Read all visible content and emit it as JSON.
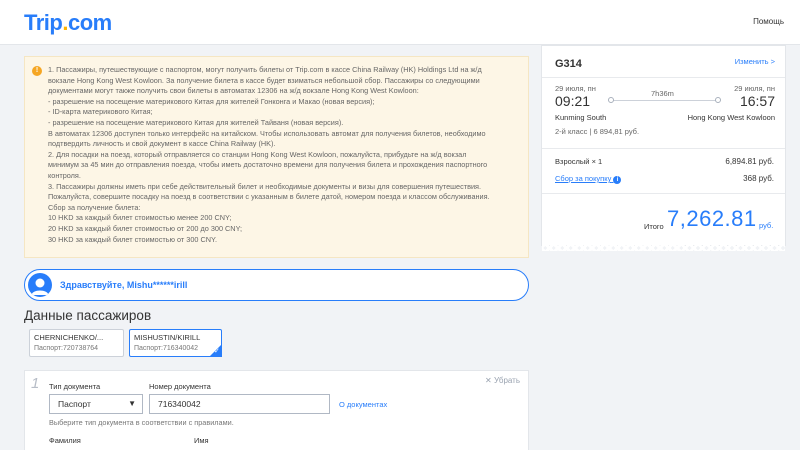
{
  "header": {
    "logo_main": "Trip",
    "logo_dot": ".",
    "logo_suffix": "com",
    "help": "Помощь"
  },
  "notice": {
    "icon": "!",
    "lines": [
      "1. Пассажиры, путешествующие с паспортом, могут получить билеты от Trip.com в кассе China Railway (HK) Holdings Ltd на ж/д",
      "вокзале Hong Kong West Kowloon. За получение билета в кассе будет взиматься небольшой сбор. Пассажиры со следующими",
      "документами могут также получить свои билеты в автоматах 12306 на ж/д вокзале Hong Kong West Kowloon:",
      "- разрешение на посещение материкового Китая для жителей Гонконга и Макао (новая версия);",
      "- ID-карта материкового Китая;",
      "- разрешение на посещение материкового Китая для жителей Тайваня (новая версия).",
      "В автоматах 12306 доступен только интерфейс на китайском. Чтобы использовать автомат для получения билетов, необходимо",
      "подтвердить личность и свой документ в кассе China Railway (HK).",
      "2. Для посадки на поезд, который отправляется со станции Hong Kong West Kowloon, пожалуйста, прибудьте на ж/д вокзал",
      "минимум за 45 мин до отправления поезда, чтобы иметь достаточно времени для получения билета и прохождения паспортного",
      "контроля.",
      "3. Пассажиры должны иметь при себе действительный билет и необходимые документы и визы для совершения путешествия.",
      "Пожалуйста, совершите посадку на поезд в соответствии с указанным в билете датой, номером поезда и классом обслуживания.",
      "Сбор за получение билета:",
      "10 HKD за каждый билет стоимостью менее 200 CNY;",
      "20 HKD за каждый билет стоимостью от 200 до 300 CNY;",
      "30 HKD за каждый билет стоимостью от 300 CNY."
    ]
  },
  "greeting": "Здравствуйте, Mishu******irill",
  "passengers": {
    "title": "Данные пассажиров",
    "cards": [
      {
        "name": "CHERNICHENKO/...",
        "doc": "Паспорт:720738764",
        "selected": false
      },
      {
        "name": "MISHUSTIN/KIRILL",
        "doc": "Паспорт:716340042",
        "selected": true
      }
    ]
  },
  "form": {
    "number": "1",
    "remove": "✕ Убрать",
    "doc_type_label": "Тип документа",
    "doc_type_value": "Паспорт",
    "doc_number_label": "Номер документа",
    "doc_number_value": "716340042",
    "doc_link": "О документах",
    "hint": "Выберите тип документа в соответствии с правилами.",
    "surname_label": "Фамилия",
    "name_label": "Имя"
  },
  "trip": {
    "train": "G314",
    "change": "Изменить >",
    "depart_date": "29 июля, пн",
    "depart_time": "09:21",
    "depart_station": "Kunming South",
    "duration": "7h36m",
    "arrive_date": "29 июля, пн",
    "arrive_time": "16:57",
    "arrive_station": "Hong Kong West Kowloon",
    "seat": "2-й класс | 6 894,81 руб.",
    "adult_label": "Взрослый × 1",
    "adult_value": "6,894.81 руб.",
    "fee_label": "Сбор за покупку",
    "fee_value": "368 руб.",
    "total_label": "Итого",
    "total_value": "7,262.81",
    "total_currency": "руб."
  },
  "colors": {
    "accent": "#287dfa",
    "notice_bg": "#fdf6e6",
    "logo_dot": "#ffb400"
  }
}
